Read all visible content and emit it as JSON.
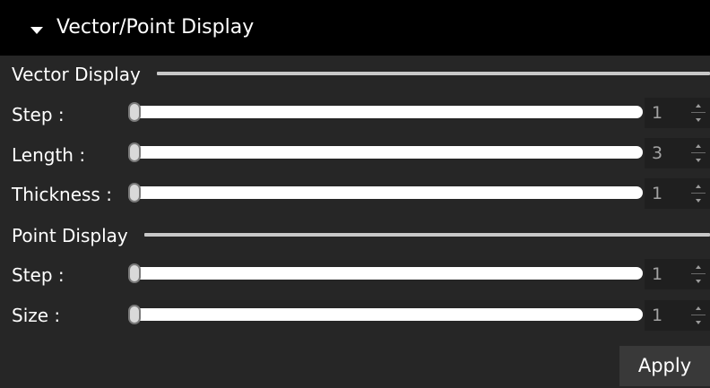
{
  "header": {
    "title": "Vector/Point Display",
    "icon": "triangle-down-icon"
  },
  "vector_display": {
    "title": "Vector Display",
    "rows": [
      {
        "label": "Step :",
        "value": "1"
      },
      {
        "label": "Length :",
        "value": "3"
      },
      {
        "label": "Thickness :",
        "value": "1"
      }
    ]
  },
  "point_display": {
    "title": "Point Display",
    "rows": [
      {
        "label": "Step :",
        "value": "1"
      },
      {
        "label": "Size :",
        "value": "1"
      }
    ]
  },
  "actions": {
    "apply_label": "Apply"
  },
  "colors": {
    "header_bg": "#000000",
    "panel_bg": "#262626",
    "track": "#ffffff",
    "spin_text": "#a3a3a3",
    "button_bg": "#393939"
  }
}
